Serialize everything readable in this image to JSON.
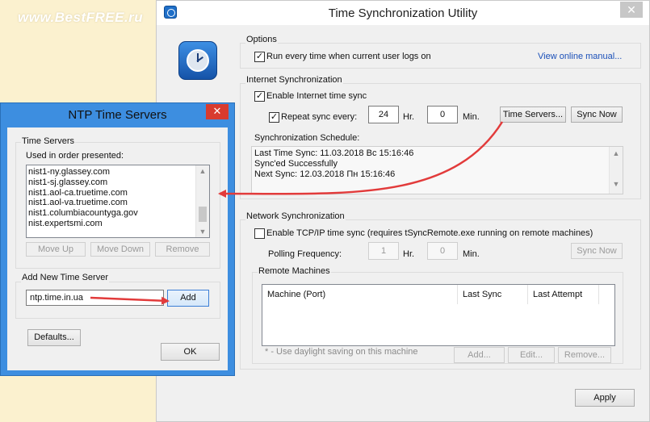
{
  "watermark": "www.BestFREE.ru",
  "main": {
    "title": "Time Synchronization Utility",
    "close": "✕",
    "options": {
      "group": "Options",
      "run_every_time": "Run every time when current user logs on",
      "view_manual": "View online manual..."
    },
    "internet": {
      "group": "Internet Synchronization",
      "enable": "Enable Internet time sync",
      "repeat": "Repeat sync every:",
      "hours_value": "24",
      "hr_unit": "Hr.",
      "min_value": "0",
      "min_unit": "Min.",
      "time_servers_btn": "Time Servers...",
      "sync_now_btn": "Sync Now",
      "schedule_label": "Synchronization Schedule:",
      "schedule_lines": [
        "Last Time Sync: 11.03.2018 Вс 15:16:46",
        "Sync'ed Successfully",
        "Next Sync: 12.03.2018 Пн 15:16:46"
      ]
    },
    "network": {
      "group": "Network Synchronization",
      "enable": "Enable TCP/IP time sync (requires tSyncRemote.exe running on remote machines)",
      "polling_label": "Polling Frequency:",
      "poll_hr_value": "1",
      "hr_unit": "Hr.",
      "poll_min_value": "0",
      "min_unit": "Min.",
      "sync_now_btn": "Sync Now",
      "remote_group": "Remote Machines",
      "columns": [
        "Machine (Port)",
        "Last Sync",
        "Last Attempt"
      ],
      "hint": "* - Use daylight saving on this machine",
      "add_btn": "Add...",
      "edit_btn": "Edit...",
      "remove_btn": "Remove..."
    },
    "apply_btn": "Apply"
  },
  "ntp": {
    "title": "NTP Time Servers",
    "close": "✕",
    "servers_group": "Time Servers",
    "used_in_order": "Used in order presented:",
    "servers": [
      "nist1-ny.glassey.com",
      "nist1-sj.glassey.com",
      "nist1.aol-ca.truetime.com",
      "nist1.aol-va.truetime.com",
      "nist1.columbiacountyga.gov",
      "nist.expertsmi.com"
    ],
    "move_up": "Move Up",
    "move_down": "Move Down",
    "remove": "Remove",
    "add_group": "Add New Time Server",
    "new_server_value": "ntp.time.in.ua",
    "add_btn": "Add",
    "defaults_btn": "Defaults...",
    "ok_btn": "OK"
  },
  "colors": {
    "ntp_frame": "#3d8ee0",
    "annotation_arrow": "#e23b3b",
    "link": "#1a4fb8"
  }
}
